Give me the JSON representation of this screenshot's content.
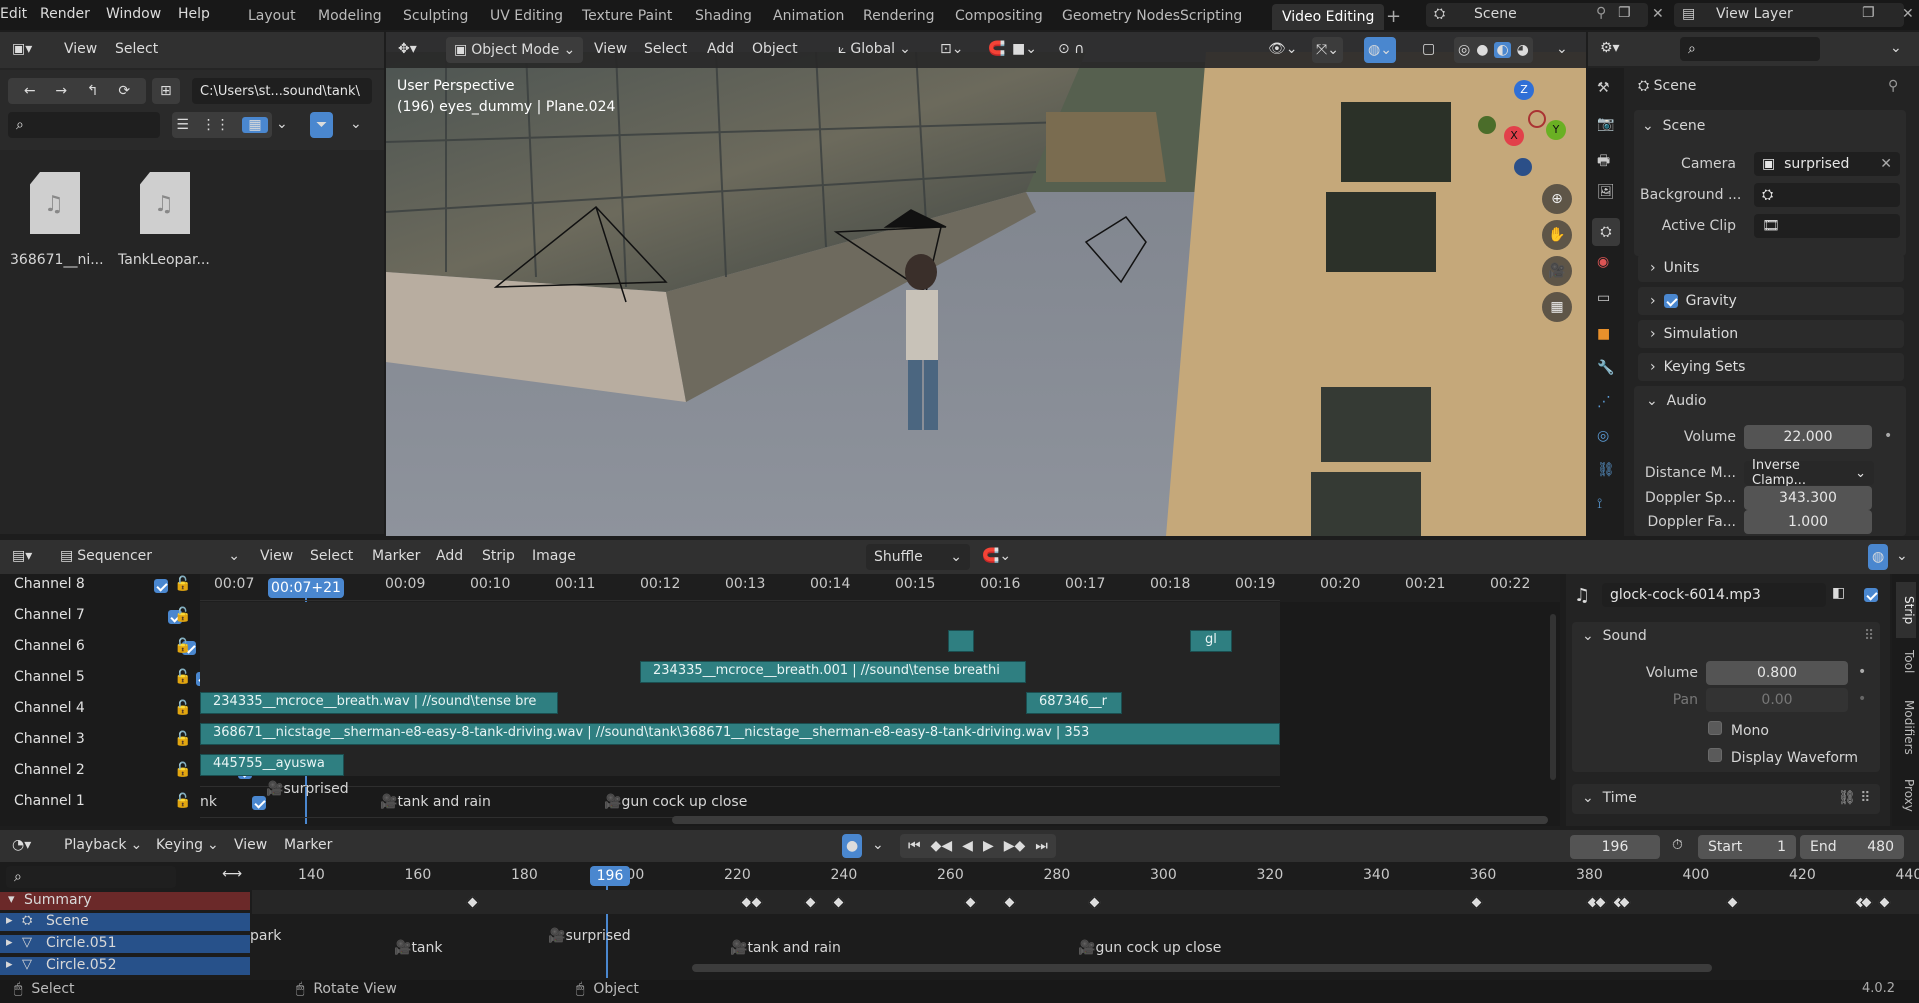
{
  "topmenu": {
    "items": [
      "Edit",
      "Render",
      "Window",
      "Help"
    ]
  },
  "workspaces": [
    "Layout",
    "Modeling",
    "Sculpting",
    "UV Editing",
    "Texture Paint",
    "Shading",
    "Animation",
    "Rendering",
    "Compositing",
    "Geometry Nodes",
    "Scripting",
    "Video Editing"
  ],
  "active_workspace": "Video Editing",
  "scene_selector": {
    "value": "Scene"
  },
  "viewlayer_selector": {
    "value": "View Layer"
  },
  "filebrowser": {
    "menu": [
      "View",
      "Select"
    ],
    "path": "C:\\Users\\st...sound\\tank\\",
    "files": [
      {
        "name": "368671__ni..."
      },
      {
        "name": "TankLeopar..."
      }
    ]
  },
  "viewport": {
    "mode": "Object Mode",
    "menu": [
      "View",
      "Select",
      "Add",
      "Object"
    ],
    "transform": "Global",
    "overlay_line1": "User Perspective",
    "overlay_line2": "(196) eyes_dummy | Plane.024",
    "axes": {
      "z": "Z",
      "y": "Y",
      "x": "X"
    }
  },
  "properties": {
    "crumb": "Scene",
    "section_scene": "Scene",
    "camera_label": "Camera",
    "camera_value": "surprised",
    "background_label": "Background ...",
    "active_clip_label": "Active Clip",
    "units": "Units",
    "gravity": "Gravity",
    "simulation": "Simulation",
    "keying_sets": "Keying Sets",
    "audio": "Audio",
    "volume_label": "Volume",
    "volume_value": "22.000",
    "distance_label": "Distance M...",
    "distance_value": "Inverse Clamp...",
    "doppler_speed_label": "Doppler Sp...",
    "doppler_speed_value": "343.300",
    "doppler_factor_label": "Doppler Fa...",
    "doppler_factor_value": "1.000"
  },
  "sequencer": {
    "editor": "Sequencer",
    "menu": [
      "View",
      "Select",
      "Marker",
      "Add",
      "Strip",
      "Image"
    ],
    "overlap_mode": "Shuffle",
    "current_time": "00:07+21",
    "timecodes": [
      "00:07",
      "00:09",
      "00:10",
      "00:11",
      "00:12",
      "00:13",
      "00:14",
      "00:15",
      "00:16",
      "00:17",
      "00:18",
      "00:19",
      "00:20",
      "00:21",
      "00:22"
    ],
    "channels": [
      "Channel 8",
      "Channel 7",
      "Channel 6",
      "Channel 5",
      "Channel 4",
      "Channel 3",
      "Channel 2",
      "Channel 1"
    ],
    "strips": {
      "s1": "",
      "s2": "gl",
      "s3": "234335__mcroce__breath.001 | //sound\\tense breathi",
      "s4": "234335__mcroce__breath.wav | //sound\\tense bre",
      "s5": "687346__r",
      "s6": "368671__nicstage__sherman-e8-easy-8-tank-driving.wav | //sound\\tank\\368671__nicstage__sherman-e8-easy-8-tank-driving.wav | 353",
      "s7": "445755__ayuswa"
    },
    "markers": [
      "nk",
      "surprised",
      "tank and rain",
      "gun cock up close"
    ]
  },
  "strip_panel": {
    "name": "glock-cock-6014.mp3",
    "sound_header": "Sound",
    "volume_label": "Volume",
    "volume_value": "0.800",
    "pan_label": "Pan",
    "pan_value": "0.00",
    "mono": "Mono",
    "display_waveform": "Display Waveform",
    "time_header": "Time",
    "tabs": [
      "Strip",
      "Tool",
      "Modifiers",
      "Proxy"
    ]
  },
  "timeline": {
    "menu": [
      "Playback",
      "Keying",
      "View",
      "Marker"
    ],
    "frame": "196",
    "start_label": "Start",
    "start_value": "1",
    "end_label": "End",
    "end_value": "480",
    "current_frame": "196",
    "ticks": [
      "140",
      "160",
      "180",
      "200",
      "220",
      "240",
      "260",
      "280",
      "300",
      "320",
      "340",
      "360",
      "380",
      "400",
      "420",
      "440"
    ],
    "channels": [
      {
        "name": "Summary"
      },
      {
        "name": "Scene"
      },
      {
        "name": "Circle.051"
      },
      {
        "name": "Circle.052"
      }
    ],
    "markers": [
      "park",
      "tank",
      "surprised",
      "tank and rain",
      "gun cock up close"
    ]
  },
  "statusbar": {
    "select": "Select",
    "rotate": "Rotate View",
    "object": "Object",
    "version": "4.0.2"
  },
  "colors": {
    "accent": "#4a87cf",
    "strip": "#2f7f81",
    "playhead": "#4a87cf",
    "summary": "#6b2929",
    "channel_blue": "#27518a"
  }
}
